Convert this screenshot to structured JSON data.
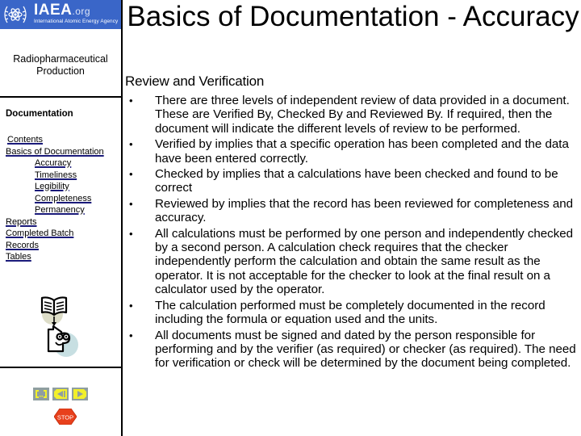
{
  "sidebar": {
    "logo": {
      "name": "IAEA",
      "suffix": ".org",
      "tagline": "International Atomic Energy Agency",
      "color": "#3a66c8"
    },
    "course_title": "Radiopharmaceutical Production",
    "section_heading": "Documentation",
    "nav_items": [
      {
        "label": "Contents",
        "level": 0
      },
      {
        "label": "Basics of Documentation",
        "level": 0
      },
      {
        "label": "Accuracy",
        "level": 1
      },
      {
        "label": "Timeliness",
        "level": 1
      },
      {
        "label": "Legibility",
        "level": 1
      },
      {
        "label": "Completeness",
        "level": 1
      },
      {
        "label": "Permanency",
        "level": 1
      },
      {
        "label": "Reports",
        "level": 0
      },
      {
        "label": "Completed Batch",
        "level": 0
      },
      {
        "label": "Records",
        "level": 0
      },
      {
        "label": "Tables",
        "level": 0
      }
    ],
    "clipart_icon": "book-to-person-icon",
    "buttons": {
      "home_icon": "home-icon",
      "back_icon": "back-icon",
      "forward_icon": "forward-icon",
      "stop_label": "STOP",
      "button_color": "#8f9ea0",
      "arrow_color": "#f2f02a",
      "stop_color": "#e8401c"
    }
  },
  "main": {
    "title": "Basics of Documentation - Accuracy",
    "subtitle": "Review and Verification",
    "bullets": [
      "There are three levels of independent review of data provided in a document.  These are Verified By, Checked By and Reviewed By.  If required, then the document will indicate the different levels of review to be performed.",
      "Verified by implies that a specific operation has been completed and the data have been entered correctly.",
      "Checked by implies that a calculations have been checked and found to be correct",
      "Reviewed by implies that the record has been reviewed for completeness and accuracy.",
      "All calculations must be performed by one person and independently checked by a second person.  A calculation check requires that the checker independently perform the calculation and obtain the same result as the operator. It is not acceptable for the checker to look at the final result on a calculator used by the operator.",
      "The calculation performed must be completely documented in the record including the formula or equation used and the units.",
      "All documents must be signed and dated by the person responsible for performing and by the verifier (as required) or checker (as required). The need for verification or check will be determined by the document being completed."
    ],
    "bullet_glyph": "•"
  }
}
